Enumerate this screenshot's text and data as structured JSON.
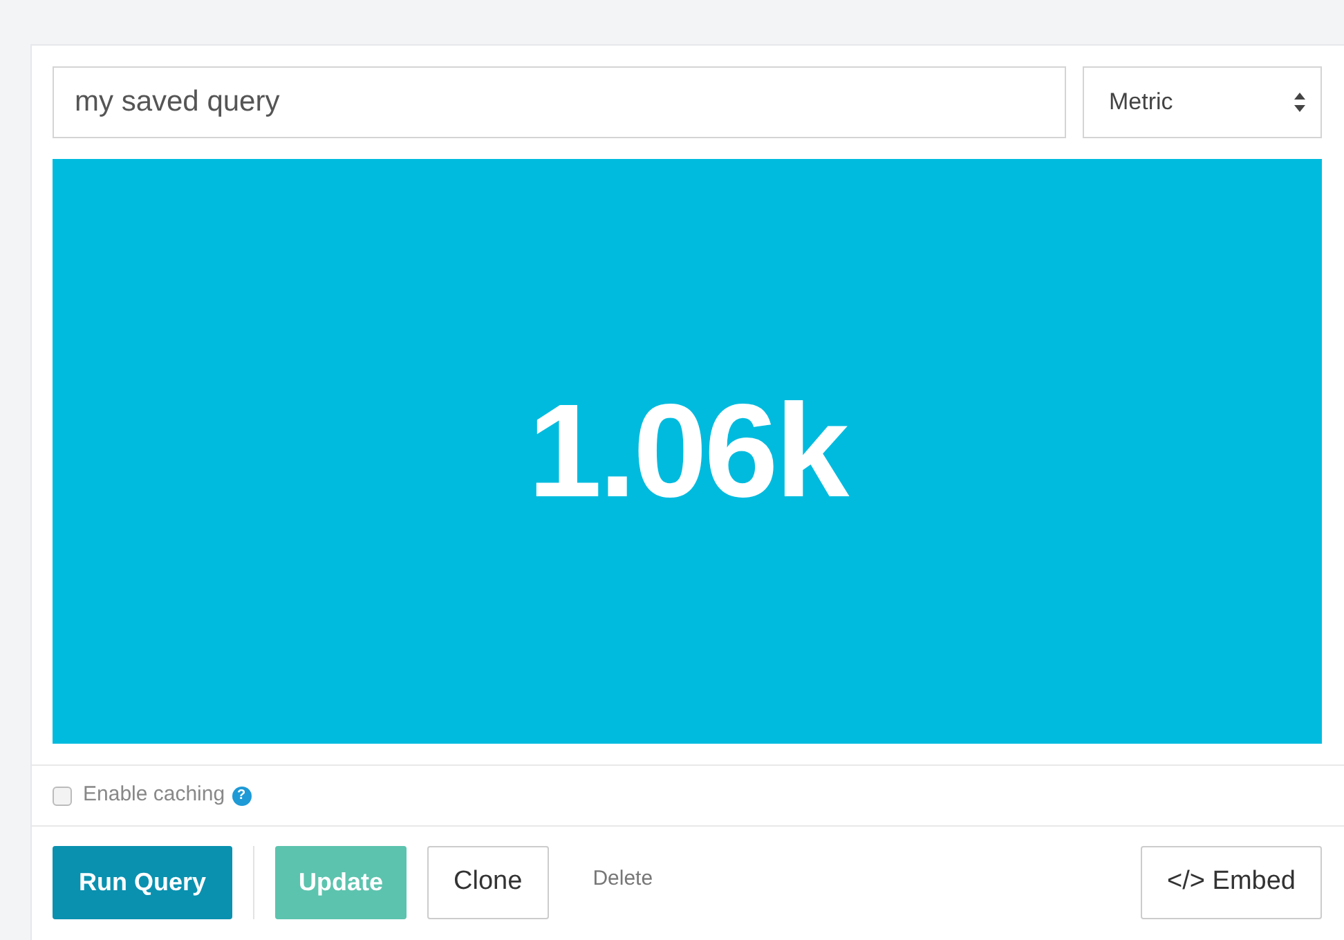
{
  "query_name": {
    "value": "my saved query"
  },
  "visualization_select": {
    "value": "Metric"
  },
  "metric": {
    "value": "1.06k"
  },
  "caching": {
    "label": "Enable caching",
    "checked": false,
    "help": "?"
  },
  "buttons": [
    {
      "kind": "primary",
      "label": "Run Query"
    },
    {
      "kind": "separator"
    },
    {
      "kind": "success",
      "label": "Update"
    },
    {
      "kind": "default",
      "label": "Clone"
    },
    {
      "kind": "link",
      "label": "Delete"
    },
    {
      "kind": "spacer"
    },
    {
      "kind": "default",
      "label": "</> Embed"
    }
  ]
}
